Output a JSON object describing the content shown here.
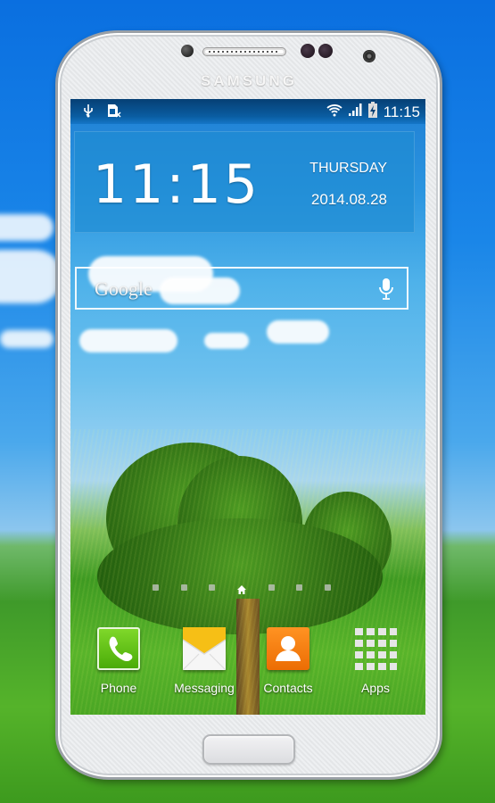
{
  "device": {
    "brand": "SAMSUNG"
  },
  "status_bar": {
    "left_icons": [
      "usb-icon",
      "no-sim-icon"
    ],
    "right_icons": [
      "wifi-icon",
      "signal-icon",
      "battery-charging-icon"
    ],
    "time": "11:15"
  },
  "clock_widget": {
    "time": "11:15",
    "day": "THURSDAY",
    "date": "2014.08.28"
  },
  "search_bar": {
    "logo_text": "Google",
    "voice_icon": "mic-icon"
  },
  "page_indicator": {
    "total_pages": 7,
    "current_index": 3,
    "current_icon": "home-icon"
  },
  "dock": {
    "apps": [
      {
        "label": "Phone",
        "icon": "phone-icon",
        "color": "#5bbf12"
      },
      {
        "label": "Messaging",
        "icon": "envelope-icon",
        "color": "#f4c21c"
      },
      {
        "label": "Contacts",
        "icon": "contact-icon",
        "color": "#f07a0e"
      },
      {
        "label": "Apps",
        "icon": "grid-icon",
        "color": "#e8e8e8"
      }
    ]
  }
}
